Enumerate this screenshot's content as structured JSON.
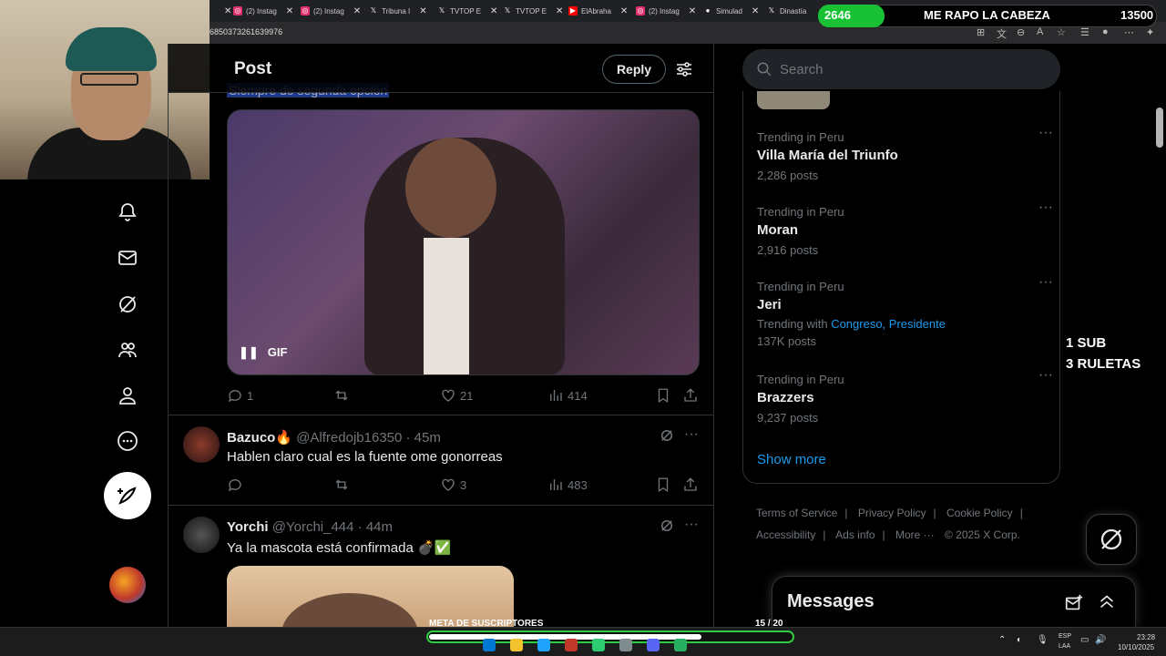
{
  "browser": {
    "tabs": [
      {
        "title": "(2) Instag",
        "icon": "instagram-icon",
        "color": "#e1306c"
      },
      {
        "title": "(2) Instag",
        "icon": "instagram-icon",
        "color": "#e1306c"
      },
      {
        "title": "Tribuna I",
        "icon": "x-icon",
        "color": "#000000"
      },
      {
        "title": "TVTOP E",
        "icon": "x-icon",
        "color": "#000000"
      },
      {
        "title": "TVTOP E",
        "icon": "x-icon",
        "color": "#000000"
      },
      {
        "title": "ElAbraha",
        "icon": "youtube-icon",
        "color": "#ff0000"
      },
      {
        "title": "(2) Instag",
        "icon": "instagram-icon",
        "color": "#e1306c"
      },
      {
        "title": "Simulad",
        "icon": "dot-icon",
        "color": "#888888"
      },
      {
        "title": "Dinastía",
        "icon": "x-icon",
        "color": "#000000"
      }
    ],
    "url": "6850373261639976"
  },
  "stream_overlay": {
    "sub_count": "2646",
    "goal_text": "ME RAPO LA CABEZA",
    "goal_target": "13500",
    "promo_line1": "1 SUB",
    "promo_line2": "3 RULETAS",
    "bottom_goal_label": "META DE SUSCRIPTORES",
    "bottom_goal_count": "15  / 20",
    "bottom_goal_fraction": 0.75,
    "sub_goal_fraction": 0.196,
    "accent_green": "#19c235"
  },
  "left_nav": {
    "items": [
      "notifications-icon",
      "messages-icon",
      "grok-icon",
      "communities-icon",
      "profile-icon",
      "more-icon"
    ],
    "post_button": "compose-icon"
  },
  "post": {
    "header_title": "Post",
    "reply_button": "Reply",
    "cut_text": "Siempre de segunda opción",
    "gif_label": "GIF",
    "actions": {
      "replies": "1",
      "likes": "21",
      "views": "414"
    }
  },
  "replies": [
    {
      "name": "Bazuco",
      "handle": "@Alfredojb16350",
      "time": "· 45m",
      "text": "Hablen claro cual es la fuente ome gonorreas",
      "replies": "",
      "likes": "3",
      "views": "483"
    },
    {
      "name": "Yorchi",
      "handle": "@Yorchi_444",
      "time": "· 44m",
      "text": "Ya la mascota está confirmada 💣✅"
    }
  ],
  "search": {
    "placeholder": "Search"
  },
  "trends": [
    {
      "context": "Trending in Peru",
      "name": "Villa María del Triunfo",
      "posts": "2,286 posts"
    },
    {
      "context": "Trending in Peru",
      "name": "Moran",
      "posts": "2,916 posts"
    },
    {
      "context": "Trending in Peru",
      "name": "Jeri",
      "with_label": "Trending with",
      "with_topics": "Congreso, Presidente",
      "posts": "137K posts"
    },
    {
      "context": "Trending in Peru",
      "name": "Brazzers",
      "posts": "9,237 posts"
    }
  ],
  "show_more": "Show more",
  "footer": {
    "terms": "Terms of Service",
    "privacy": "Privacy Policy",
    "cookie": "Cookie Policy",
    "accessibility": "Accessibility",
    "ads": "Ads info",
    "more": "More ···",
    "copyright": "© 2025 X Corp."
  },
  "messages": {
    "title": "Messages"
  },
  "taskbar": {
    "lang1": "ESP",
    "lang2": "LAA",
    "time": "23:28",
    "date": "10/10/2025"
  },
  "colors": {
    "accent_blue": "#1d9bf0",
    "muted": "#71767b",
    "border": "#2f3336"
  }
}
